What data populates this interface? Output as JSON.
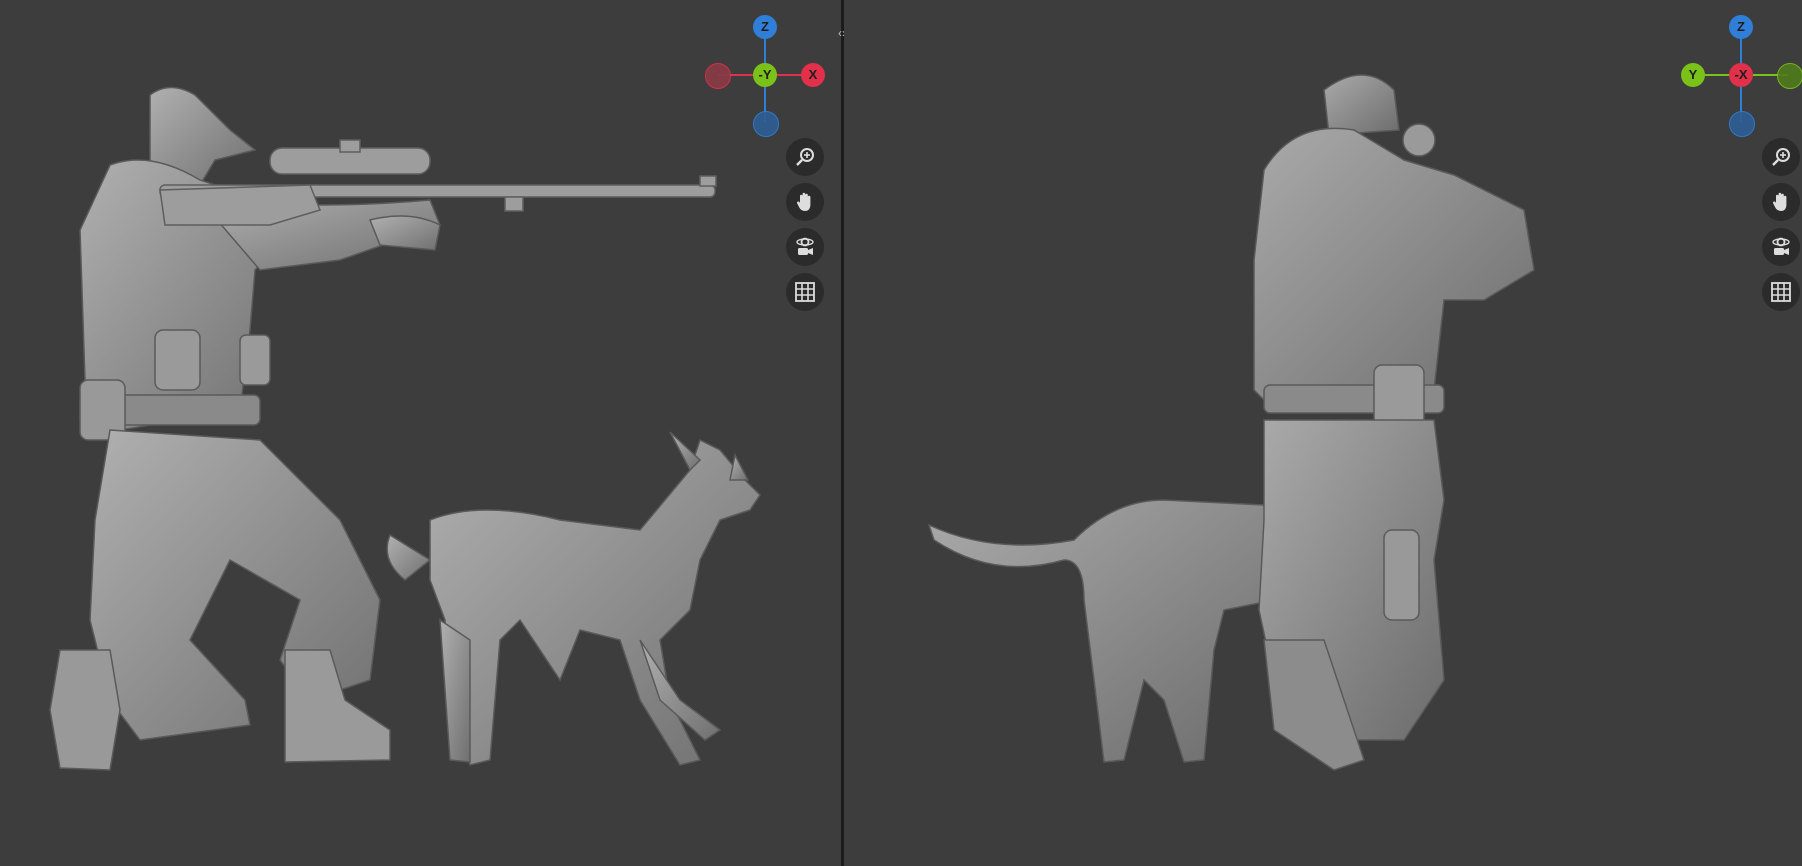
{
  "app": {
    "title": ""
  },
  "viewports": [
    {
      "id": "left",
      "gizmo": {
        "top_label": "Z",
        "center_label": "-Y",
        "right_label": "X",
        "left_label": "",
        "bottom_label": "",
        "colors": {
          "z": "#2f7fd8",
          "y": "#7ac21a",
          "x": "#e0304a",
          "x_dim": "#8a3a45",
          "z_dim": "#2e5e95"
        }
      },
      "tools": [
        "zoom-icon",
        "pan-hand-icon",
        "orbit-camera-icon",
        "grid-icon"
      ]
    },
    {
      "id": "right",
      "gizmo": {
        "top_label": "Z",
        "center_label": "-X",
        "left_label": "Y",
        "right_label": "",
        "bottom_label": "",
        "colors": {
          "z": "#2f7fd8",
          "y": "#7ac21a",
          "x": "#e0304a",
          "y_dim": "#4f7a1c",
          "z_dim": "#2e5e95"
        }
      },
      "tools": [
        "zoom-icon",
        "pan-hand-icon",
        "orbit-camera-icon",
        "grid-icon"
      ]
    }
  ],
  "split_handle": {
    "glyph": "‹›"
  },
  "model": {
    "description_visible": false,
    "fill": "#8e8e8e",
    "shade": "#6e6e6e",
    "highlight": "#b4b4b4"
  }
}
